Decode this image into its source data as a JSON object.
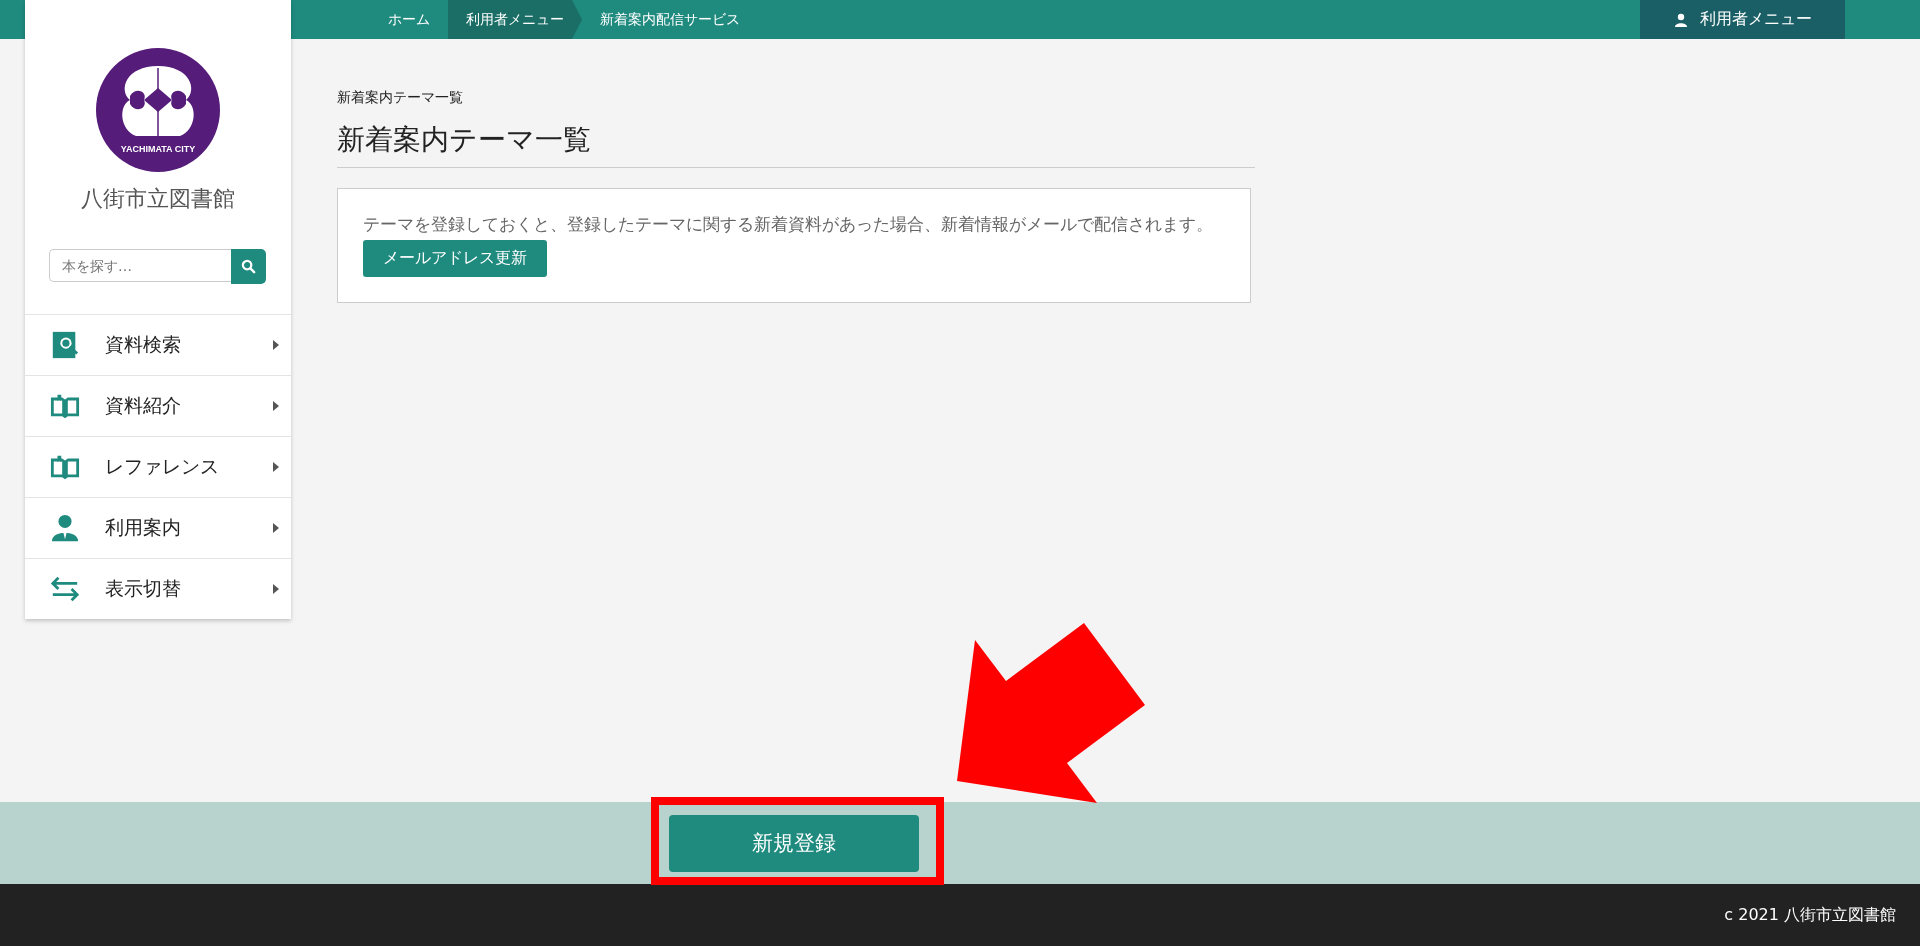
{
  "breadcrumbs": [
    {
      "label": "ホーム",
      "highlighted": false
    },
    {
      "label": "利用者メニュー",
      "highlighted": true
    },
    {
      "label": "新着案内配信サービス",
      "highlighted": false
    }
  ],
  "user_menu": "利用者メニュー",
  "sidebar": {
    "logo_text": "YACHIMATA CITY",
    "library_name": "八街市立図書館",
    "search": {
      "placeholder": "本を探す…"
    },
    "items": [
      {
        "label": "資料検索",
        "kind": "search"
      },
      {
        "label": "資料紹介",
        "kind": "intro"
      },
      {
        "label": "レファレンス",
        "kind": "reference"
      },
      {
        "label": "利用案内",
        "kind": "guide"
      },
      {
        "label": "表示切替",
        "kind": "switch"
      }
    ]
  },
  "page": {
    "small_title": "新着案内テーマ一覧",
    "title": "新着案内テーマ一覧",
    "notice": "テーマを登録しておくと、登録したテーマに関する新着資料があった場合、新着情報がメールで配信されます。",
    "email_button": "メールアドレス更新"
  },
  "action_bar": {
    "register_button": "新規登録"
  },
  "footer": {
    "copyright": "c 2021 八街市立図書館"
  }
}
